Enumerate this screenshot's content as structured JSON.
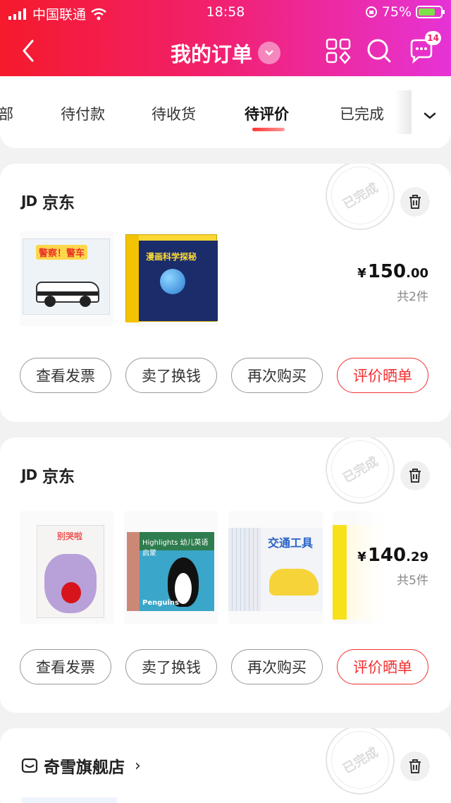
{
  "status_bar": {
    "carrier": "中国联通",
    "time": "18:58",
    "battery": "75%",
    "battery_level": 0.75
  },
  "nav": {
    "title": "我的订单",
    "message_badge": "14"
  },
  "tabs": [
    {
      "label": "部",
      "active": false
    },
    {
      "label": "待付款",
      "active": false
    },
    {
      "label": "待收货",
      "active": false
    },
    {
      "label": "待评价",
      "active": true
    },
    {
      "label": "已完成",
      "active": false
    }
  ],
  "orders": [
    {
      "shop": "京东",
      "shop_logo": "JD",
      "stamp": "已完成",
      "price_currency": "¥",
      "price_int": "150",
      "price_dec": ".00",
      "count": "共2件",
      "products": [
        "police-car-book",
        "space-science-box"
      ],
      "actions": [
        "查看发票",
        "卖了换钱",
        "再次购买",
        "评价晒单"
      ]
    },
    {
      "shop": "京东",
      "shop_logo": "JD",
      "stamp": "已完成",
      "price_currency": "¥",
      "price_int": "140",
      "price_dec": ".29",
      "count": "共5件",
      "products": [
        "mouse-picture-book",
        "highlights-penguins-book",
        "vehicles-box-set",
        "yellow-book"
      ],
      "actions": [
        "查看发票",
        "卖了换钱",
        "再次购买",
        "评价晒单"
      ]
    },
    {
      "shop": "奇雪旗舰店",
      "shop_chevron": "›",
      "stamp": "已完成"
    }
  ],
  "product_text": {
    "book_a_title": "警察！警车",
    "box_b_title": "漫画科学探秘",
    "mouse_title": "别哭啦",
    "peng_banner": "Highlights 幼儿英语启蒙",
    "peng_caption": "Penguins",
    "car_label": "交通工具"
  },
  "colors": {
    "accent": "#f23030",
    "header_start": "#f51a2c",
    "header_end": "#e633d6"
  }
}
